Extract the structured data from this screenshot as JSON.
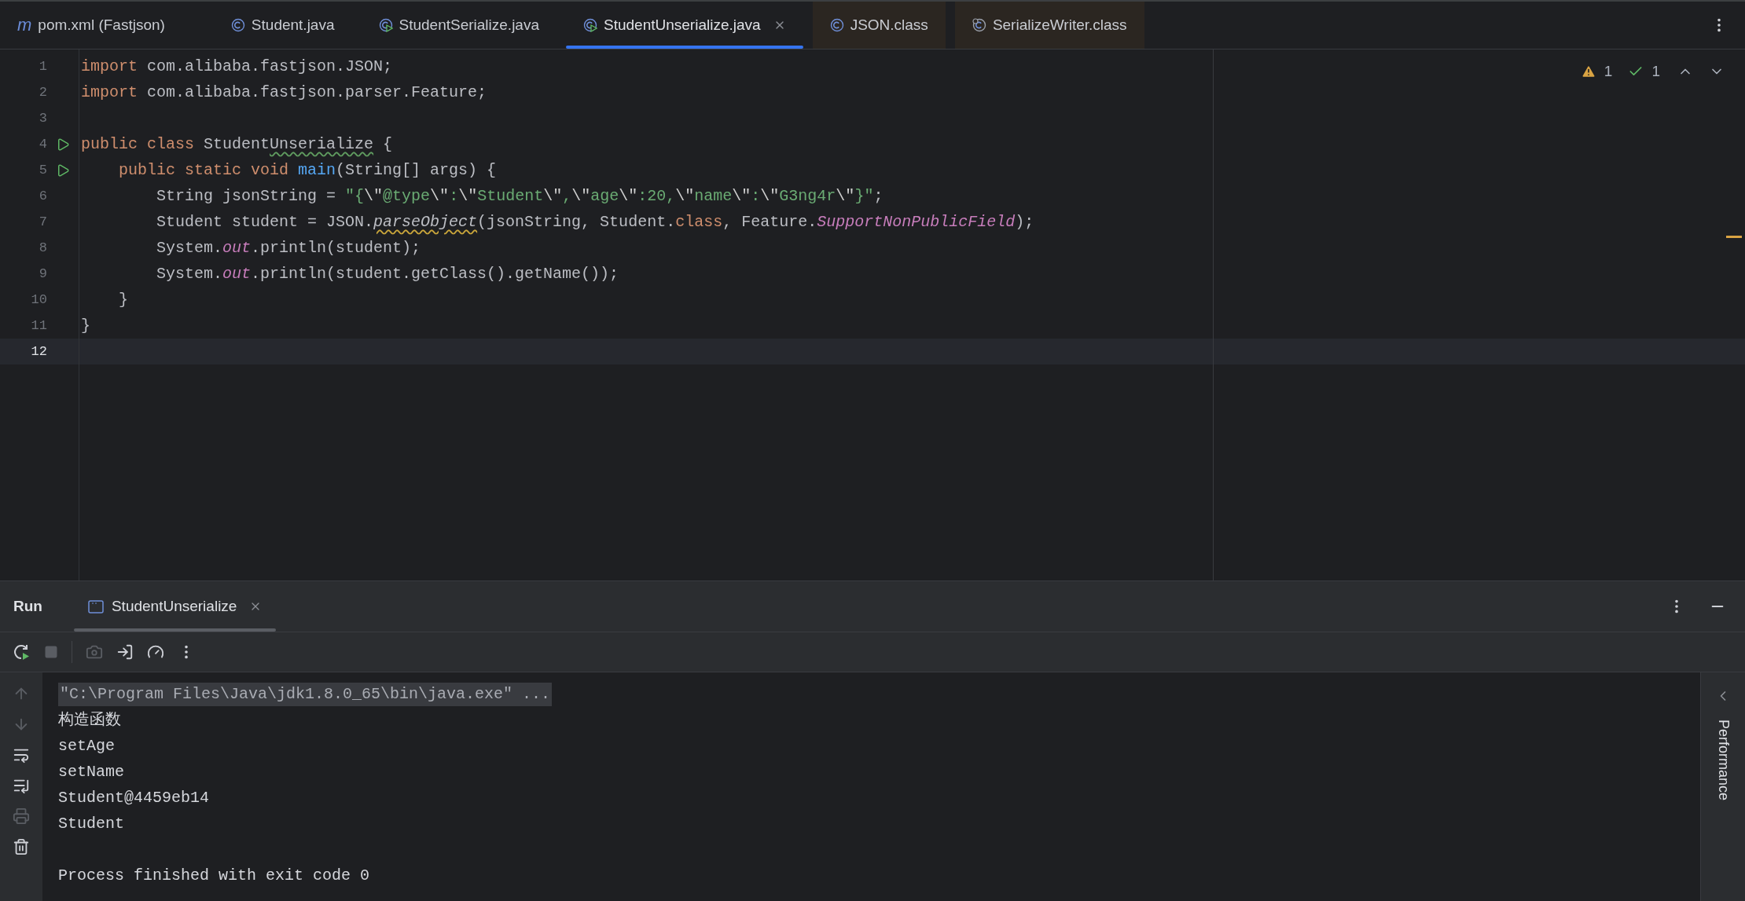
{
  "tabs": [
    {
      "label": "pom.xml (Fastjson)",
      "kind": "letter",
      "glyph": "m",
      "selected": false,
      "library": false
    },
    {
      "label": "Student.java",
      "kind": "class",
      "selected": false,
      "library": false
    },
    {
      "label": "StudentSerialize.java",
      "kind": "runnable",
      "selected": false,
      "library": false
    },
    {
      "label": "StudentUnserialize.java",
      "kind": "runnable",
      "selected": true,
      "library": false
    },
    {
      "label": "JSON.class",
      "kind": "class",
      "selected": false,
      "library": true
    },
    {
      "label": "SerializeWriter.class",
      "kind": "compiled",
      "selected": false,
      "library": true
    }
  ],
  "editor": {
    "inspection": {
      "warnings": "1",
      "typos": "1"
    },
    "lines": [
      {
        "number": "1",
        "run_marker": false,
        "current": false,
        "tokens": [
          {
            "text": "import",
            "kind": "kw"
          },
          {
            "text": " com.alibaba.fastjson.JSON;",
            "kind": "plain"
          }
        ]
      },
      {
        "number": "2",
        "run_marker": false,
        "current": false,
        "tokens": [
          {
            "text": "import",
            "kind": "kw"
          },
          {
            "text": " com.alibaba.fastjson.parser.Feature;",
            "kind": "plain"
          }
        ]
      },
      {
        "number": "3",
        "run_marker": false,
        "current": false
      },
      {
        "number": "4",
        "run_marker": true,
        "current": false,
        "tokens": [
          {
            "text": "public class",
            "kind": "kw"
          },
          {
            "text": " Student",
            "kind": "plain"
          },
          {
            "text": "Unserialize",
            "kind": "typo"
          },
          {
            "text": " {",
            "kind": "plain"
          }
        ]
      },
      {
        "number": "5",
        "run_marker": true,
        "current": false,
        "tokens": [
          {
            "text": "    public static void ",
            "kind": "kw"
          },
          {
            "text": "main",
            "kind": "fn"
          },
          {
            "text": "(String[] args) {",
            "kind": "plain"
          }
        ]
      },
      {
        "number": "6",
        "run_marker": false,
        "current": false,
        "tokens": [
          {
            "text": "        String jsonString = ",
            "kind": "plain"
          },
          {
            "text": "\"{",
            "kind": "str"
          },
          {
            "text": "\\\"",
            "kind": "esc"
          },
          {
            "text": "@type",
            "kind": "str"
          },
          {
            "text": "\\\"",
            "kind": "esc"
          },
          {
            "text": ":",
            "kind": "str"
          },
          {
            "text": "\\\"",
            "kind": "esc"
          },
          {
            "text": "Student",
            "kind": "str"
          },
          {
            "text": "\\\"",
            "kind": "esc"
          },
          {
            "text": ",",
            "kind": "str"
          },
          {
            "text": "\\\"",
            "kind": "esc"
          },
          {
            "text": "age",
            "kind": "str"
          },
          {
            "text": "\\\"",
            "kind": "esc"
          },
          {
            "text": ":20,",
            "kind": "str"
          },
          {
            "text": "\\\"",
            "kind": "esc"
          },
          {
            "text": "name",
            "kind": "str"
          },
          {
            "text": "\\\"",
            "kind": "esc"
          },
          {
            "text": ":",
            "kind": "str"
          },
          {
            "text": "\\\"",
            "kind": "esc"
          },
          {
            "text": "G3ng4r",
            "kind": "str"
          },
          {
            "text": "\\\"",
            "kind": "esc"
          },
          {
            "text": "}\"",
            "kind": "str"
          },
          {
            "text": ";",
            "kind": "plain"
          }
        ]
      },
      {
        "number": "7",
        "run_marker": false,
        "current": false,
        "tokens": [
          {
            "text": "        Student student = JSON.",
            "kind": "plain"
          },
          {
            "text": "parseObject",
            "kind": "deprecated"
          },
          {
            "text": "(jsonString, Student.",
            "kind": "plain"
          },
          {
            "text": "class",
            "kind": "kw"
          },
          {
            "text": ", Feature.",
            "kind": "plain"
          },
          {
            "text": "SupportNonPublicField",
            "kind": "field"
          },
          {
            "text": ");",
            "kind": "plain"
          }
        ]
      },
      {
        "number": "8",
        "run_marker": false,
        "current": false,
        "tokens": [
          {
            "text": "        System.",
            "kind": "plain"
          },
          {
            "text": "out",
            "kind": "field"
          },
          {
            "text": ".println(student);",
            "kind": "plain"
          }
        ]
      },
      {
        "number": "9",
        "run_marker": false,
        "current": false,
        "tokens": [
          {
            "text": "        System.",
            "kind": "plain"
          },
          {
            "text": "out",
            "kind": "field"
          },
          {
            "text": ".println(student.getClass().getName());",
            "kind": "plain"
          }
        ]
      },
      {
        "number": "10",
        "run_marker": false,
        "current": false,
        "tokens": [
          {
            "text": "    }",
            "kind": "plain"
          }
        ]
      },
      {
        "number": "11",
        "run_marker": false,
        "current": false,
        "tokens": [
          {
            "text": "}",
            "kind": "plain"
          }
        ]
      },
      {
        "number": "12",
        "run_marker": false,
        "current": true
      }
    ]
  },
  "run_panel": {
    "title": "Run",
    "tabs": [
      {
        "label": "StudentUnserialize",
        "selected": true
      }
    ],
    "toolbar": [
      {
        "kind": "rerun",
        "disabled": false
      },
      {
        "kind": "stop",
        "disabled": true
      },
      {
        "kind": "separator"
      },
      {
        "kind": "camera",
        "disabled": true
      },
      {
        "kind": "exit",
        "disabled": false
      },
      {
        "kind": "gauge",
        "disabled": false
      },
      {
        "kind": "more",
        "disabled": false
      }
    ],
    "gutter": [
      {
        "kind": "up",
        "disabled": true
      },
      {
        "kind": "down",
        "disabled": true
      },
      {
        "kind": "wrap",
        "disabled": false
      },
      {
        "kind": "scroll-end",
        "disabled": false
      },
      {
        "kind": "print",
        "disabled": true
      },
      {
        "kind": "trash",
        "disabled": false
      }
    ],
    "console": [
      {
        "kind": "command",
        "text": "\"C:\\Program Files\\Java\\jdk1.8.0_65\\bin\\java.exe\" ..."
      },
      {
        "kind": "output",
        "text": "构造函数"
      },
      {
        "kind": "output",
        "text": "setAge"
      },
      {
        "kind": "output",
        "text": "setName"
      },
      {
        "kind": "output",
        "text": "Student@4459eb14"
      },
      {
        "kind": "output",
        "text": "Student"
      },
      {
        "kind": "blank"
      },
      {
        "kind": "output",
        "text": "Process finished with exit code 0"
      }
    ],
    "side_tab": "Performance"
  }
}
